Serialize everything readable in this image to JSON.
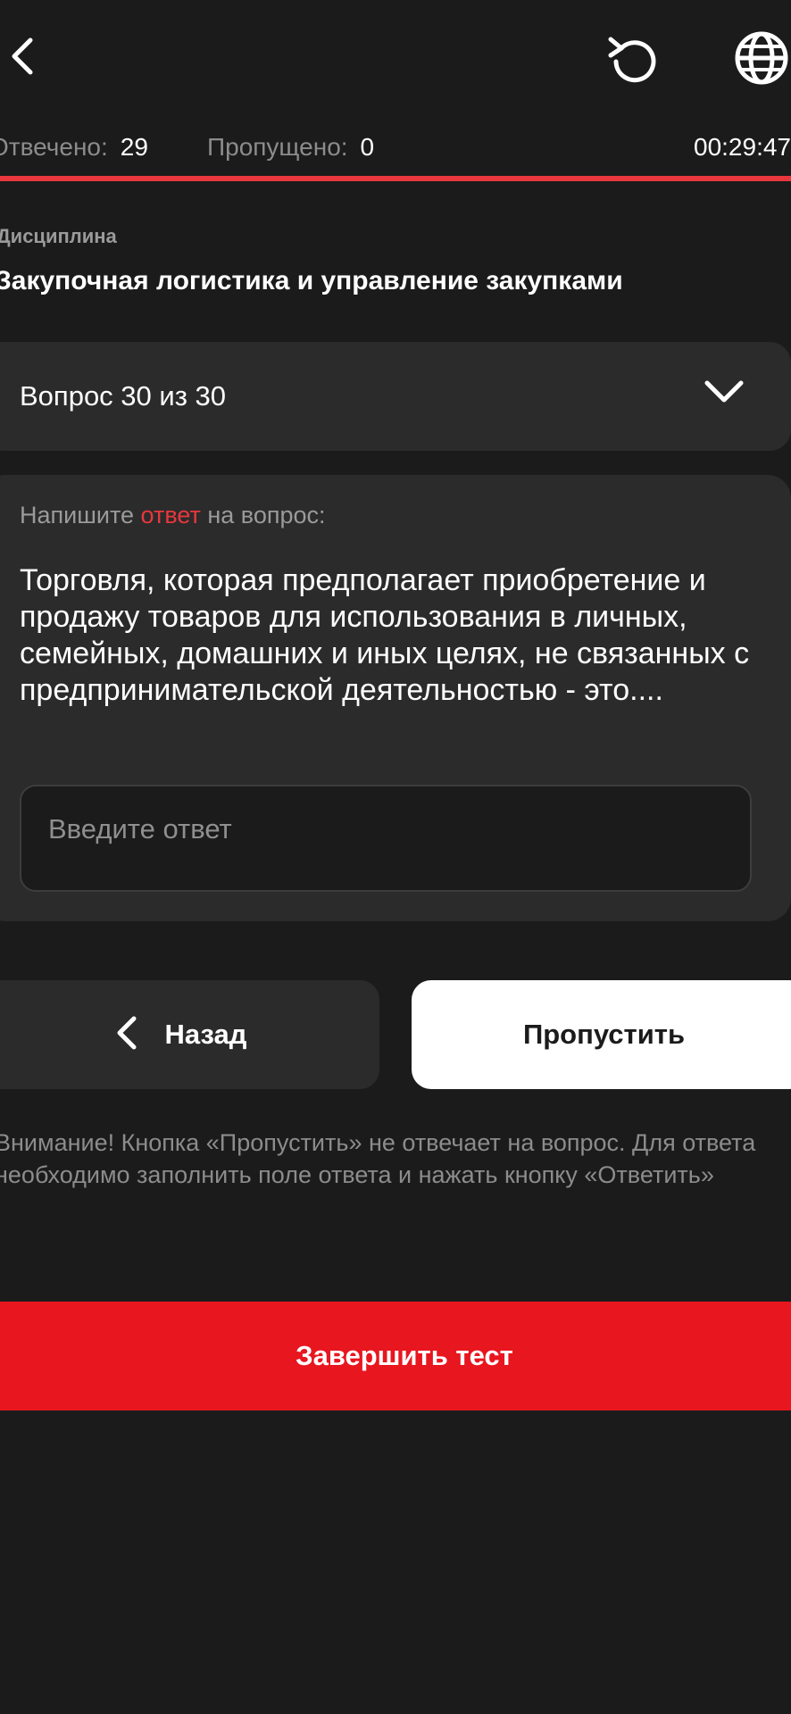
{
  "header": {
    "back_icon": "chevron-left-icon",
    "reset_icon": "reset-icon",
    "language_icon": "globe-icon"
  },
  "stats": {
    "answered_label": "Отвечено:",
    "answered_value": "29",
    "skipped_label": "Пропущено:",
    "skipped_value": "0",
    "timer": "00:29:47"
  },
  "progress": {
    "fraction": 1.0,
    "color": "#e8373d"
  },
  "discipline": {
    "label": "Дисциплина",
    "name": "Закупочная логистика и управление закупками"
  },
  "question_selector": {
    "label": "Вопрос 30 из 30",
    "icon": "chevron-down-icon"
  },
  "question": {
    "prompt_before": "Напишите ",
    "prompt_accent": "ответ",
    "prompt_after": " на вопрос:",
    "text": "Торговля, которая предполагает приобретение и продажу товаров для использования в личных, семейных, домашних и иных целях, не связанных с предпринимательской деятельностью - это....",
    "answer_value": "",
    "answer_placeholder": "Введите ответ"
  },
  "buttons": {
    "back_label": "Назад",
    "skip_label": "Пропустить",
    "finish_label": "Завершить тест"
  },
  "warning": "Внимание! Кнопка «Пропустить» не отвечает на вопрос. Для ответа необходимо заполнить поле ответа и нажать кнопку «Ответить»",
  "colors": {
    "background": "#1b1b1b",
    "card": "#2b2b2b",
    "accent": "#e8373d",
    "finish_button": "#e8161f"
  }
}
